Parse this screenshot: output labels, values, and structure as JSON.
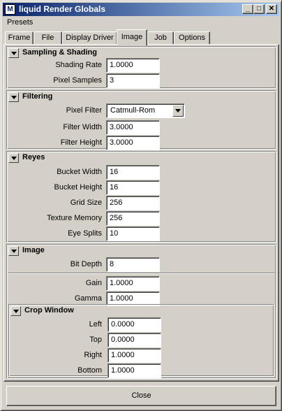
{
  "window": {
    "title": "liquid Render Globals",
    "minimize_glyph": "_",
    "maximize_glyph": "□",
    "close_glyph": "✕"
  },
  "menubar": {
    "presets": "Presets"
  },
  "tabs": [
    {
      "label": "Frame"
    },
    {
      "label": "File"
    },
    {
      "label": "Display Driver"
    },
    {
      "label": "Image",
      "active": true
    },
    {
      "label": "Job"
    },
    {
      "label": "Options"
    }
  ],
  "sections": {
    "sampling": {
      "title": "Sampling & Shading",
      "shading_rate_label": "Shading Rate",
      "shading_rate": "1.0000",
      "pixel_samples_label": "Pixel Samples",
      "pixel_samples": "3"
    },
    "filtering": {
      "title": "Filtering",
      "pixel_filter_label": "Pixel Filter",
      "pixel_filter": "Catmull-Rom",
      "filter_width_label": "Filter Width",
      "filter_width": "3.0000",
      "filter_height_label": "Filter Height",
      "filter_height": "3.0000"
    },
    "reyes": {
      "title": "Reyes",
      "bucket_width_label": "Bucket Width",
      "bucket_width": "16",
      "bucket_height_label": "Bucket Height",
      "bucket_height": "16",
      "grid_size_label": "Grid Size",
      "grid_size": "256",
      "texture_memory_label": "Texture Memory",
      "texture_memory": "256",
      "eye_splits_label": "Eye Splits",
      "eye_splits": "10"
    },
    "image": {
      "title": "Image",
      "bit_depth_label": "Bit Depth",
      "bit_depth": "8",
      "gain_label": "Gain",
      "gain": "1.0000",
      "gamma_label": "Gamma",
      "gamma": "1.0000"
    },
    "crop_window": {
      "title": "Crop Window",
      "left_label": "Left",
      "left": "0.0000",
      "top_label": "Top",
      "top": "0.0000",
      "right_label": "Right",
      "right": "1.0000",
      "bottom_label": "Bottom",
      "bottom": "1.0000"
    }
  },
  "footer": {
    "close_label": "Close"
  }
}
